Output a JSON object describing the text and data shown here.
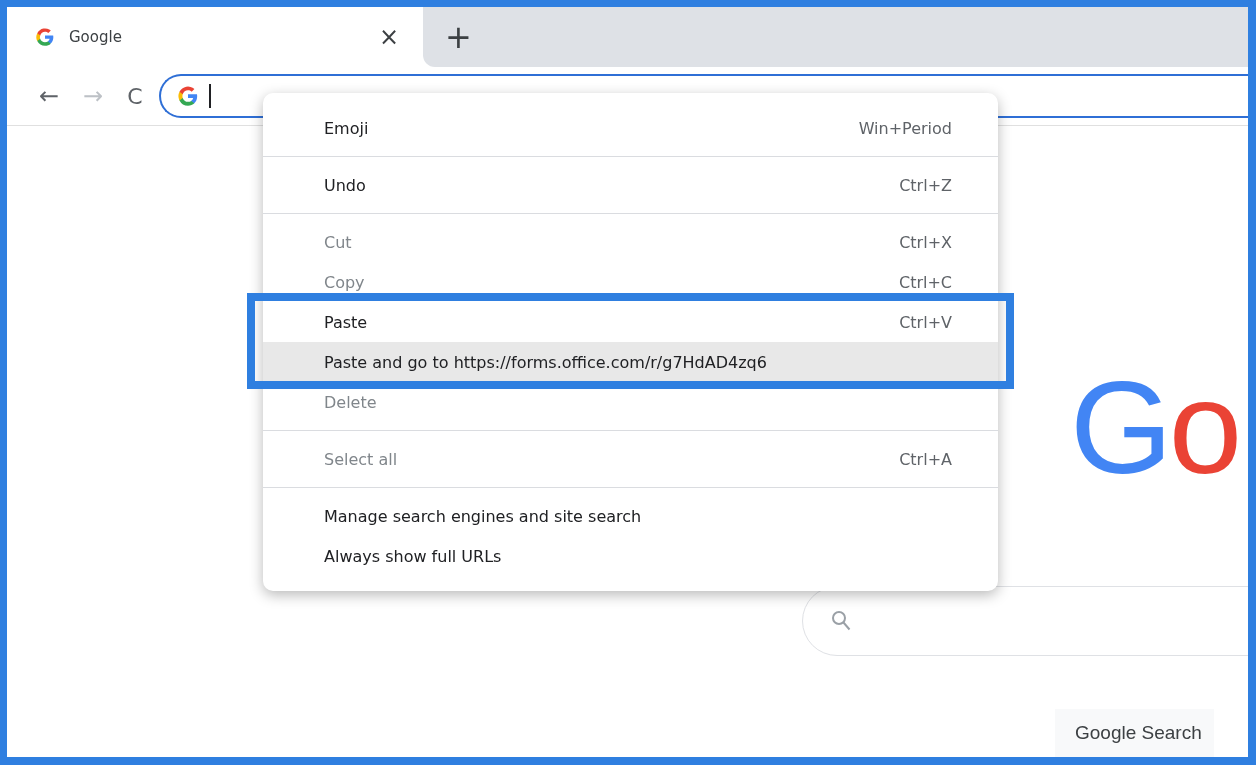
{
  "tabs": [
    {
      "title": "Google",
      "selected": true,
      "close": "×"
    }
  ],
  "new_tab": "+",
  "toolbar": {
    "back": "←",
    "forward": "→",
    "forward_disabled": true,
    "reload": "C"
  },
  "address_bar": {
    "focused": true
  },
  "context_menu": {
    "items": [
      {
        "kind": "item",
        "label": "Emoji",
        "shortcut": "Win+Period",
        "disabled": false,
        "selected": false
      },
      {
        "kind": "separator"
      },
      {
        "kind": "item",
        "label": "Undo",
        "shortcut": "Ctrl+Z",
        "disabled": false,
        "selected": false
      },
      {
        "kind": "separator"
      },
      {
        "kind": "item",
        "label": "Cut",
        "shortcut": "Ctrl+X",
        "disabled": true,
        "selected": false
      },
      {
        "kind": "item",
        "label": "Copy",
        "shortcut": "Ctrl+C",
        "disabled": true,
        "selected": false
      },
      {
        "kind": "item",
        "label": "Paste",
        "shortcut": "Ctrl+V",
        "disabled": false,
        "selected": false
      },
      {
        "kind": "item",
        "label": "Paste and go to https://forms.office.com/r/g7HdAD4zq6",
        "disabled": false,
        "selected": true
      },
      {
        "kind": "item",
        "label": "Delete",
        "disabled": true,
        "selected": false
      },
      {
        "kind": "separator"
      },
      {
        "kind": "item",
        "label": "Select all",
        "shortcut": "Ctrl+A",
        "disabled": true,
        "selected": false
      },
      {
        "kind": "separator"
      },
      {
        "kind": "item",
        "label": "Manage search engines and site search",
        "disabled": false,
        "selected": false
      },
      {
        "kind": "item",
        "label": "Always show full URLs",
        "disabled": false,
        "selected": false
      }
    ]
  },
  "page": {
    "logo": "Go",
    "search_button": "Google Search"
  }
}
